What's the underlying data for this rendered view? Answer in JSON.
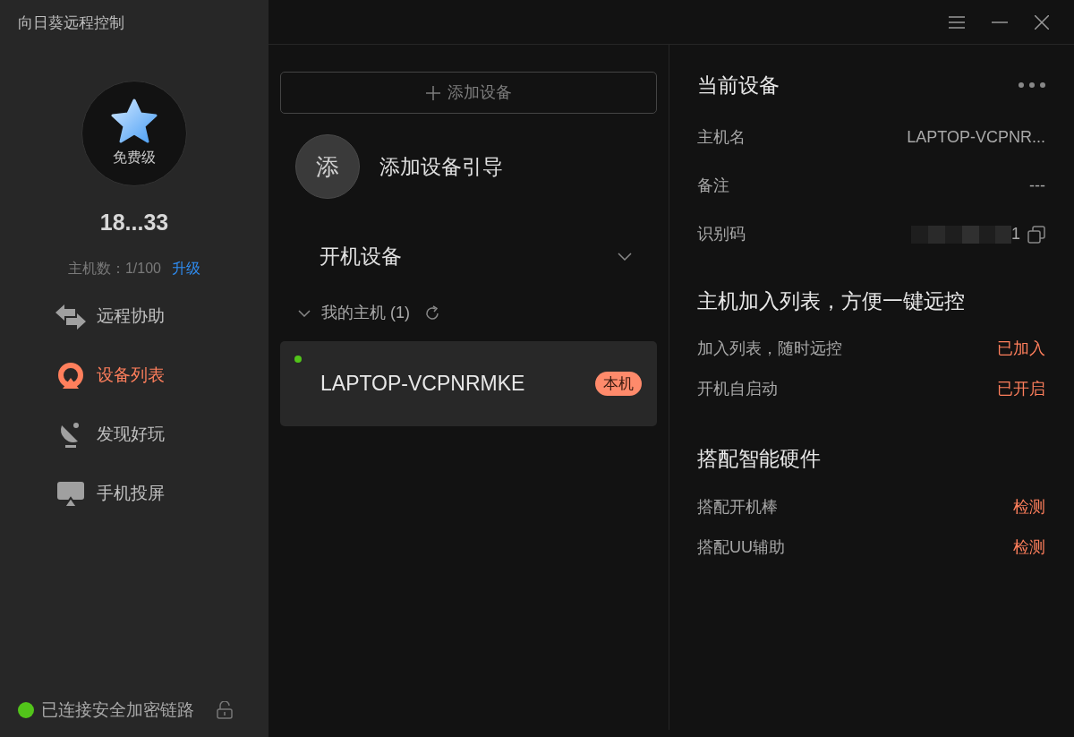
{
  "window": {
    "title": "向日葵远程控制"
  },
  "sidebar": {
    "badge": "免费级",
    "account": "18...33",
    "host_count": "主机数：1/100",
    "upgrade": "升级",
    "items": [
      {
        "label": "远程协助",
        "kind": "arrows",
        "selected": false
      },
      {
        "label": "设备列表",
        "kind": "devices",
        "selected": true
      },
      {
        "label": "发现好玩",
        "kind": "dish",
        "selected": false
      },
      {
        "label": "手机投屏",
        "kind": "cast",
        "selected": false
      }
    ],
    "status": {
      "text": "已连接安全加密链路",
      "color": "#52c41a"
    }
  },
  "device_list": {
    "add_button": "添加设备",
    "guide": {
      "avatar": "添",
      "label": "添加设备引导"
    },
    "filter": "开机设备",
    "group": {
      "label": "我的主机 (1)",
      "expanded": true
    },
    "devices": [
      {
        "name": "LAPTOP-VCPNRMKE",
        "online": true,
        "tag": "本机",
        "selected": true
      }
    ]
  },
  "details": {
    "title": "当前设备",
    "info": [
      {
        "label": "主机名",
        "value": "LAPTOP-VCPNR..."
      },
      {
        "label": "备注",
        "value": "---"
      },
      {
        "label": "识别码",
        "value": "1",
        "kind": "code"
      }
    ],
    "sections": [
      {
        "title": "主机加入列表，方便一键远控",
        "rows": [
          {
            "label": "加入列表，随时远控",
            "value": "已加入"
          },
          {
            "label": "开机自启动",
            "value": "已开启"
          }
        ]
      },
      {
        "title": "搭配智能硬件",
        "rows": [
          {
            "label": "搭配开机棒",
            "value": "检测"
          },
          {
            "label": "搭配UU辅助",
            "value": "检测"
          }
        ]
      }
    ]
  }
}
